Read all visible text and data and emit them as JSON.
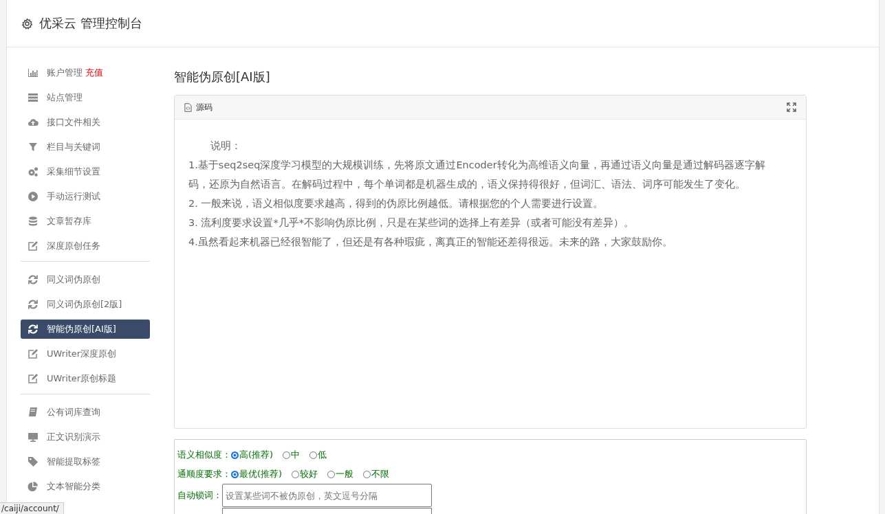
{
  "header": {
    "title": "优采云 管理控制台"
  },
  "sidebar": {
    "groups": [
      {
        "items": [
          {
            "label": "账户管理",
            "badge": "充值",
            "kind": "chart",
            "selected": false
          },
          {
            "label": "站点管理",
            "kind": "server",
            "selected": false
          },
          {
            "label": "接口文件相关",
            "kind": "cloud",
            "selected": false
          },
          {
            "label": "栏目与关键词",
            "kind": "filter",
            "selected": false
          },
          {
            "label": "采集细节设置",
            "kind": "gears",
            "selected": false
          },
          {
            "label": "手动运行测试",
            "kind": "play",
            "selected": false
          },
          {
            "label": "文章暂存库",
            "kind": "db",
            "selected": false
          },
          {
            "label": "深度原创任务",
            "kind": "edit",
            "selected": false
          }
        ]
      },
      {
        "items": [
          {
            "label": "同义词伪原创",
            "kind": "refresh",
            "selected": false
          },
          {
            "label": "同义词伪原创[2版]",
            "kind": "refresh",
            "selected": false
          },
          {
            "label": "智能伪原创[AI版]",
            "kind": "refresh",
            "selected": true
          },
          {
            "label": "UWriter深度原创",
            "kind": "edit",
            "selected": false
          },
          {
            "label": "UWriter原创标题",
            "kind": "edit",
            "selected": false
          }
        ]
      },
      {
        "items": [
          {
            "label": "公有词库查询",
            "kind": "book",
            "selected": false
          },
          {
            "label": "正文识别演示",
            "kind": "monitor",
            "selected": false
          },
          {
            "label": "智能提取标签",
            "kind": "tag",
            "selected": false
          },
          {
            "label": "文本智能分类",
            "kind": "pie",
            "selected": false
          }
        ]
      }
    ]
  },
  "content": {
    "title": "智能伪原创[AI版]",
    "editor": {
      "toolbar_label": "源码",
      "heading": "说明：",
      "paragraphs": [
        "1.基于seq2seq深度学习模型的大规模训练，先将原文通过Encoder转化为高维语义向量，再通过语义向量是通过解码器逐字解码，还原为自然语言。在解码过程中，每个单词都是机器生成的，语义保持得很好，但词汇、语法、词序可能发生了变化。",
        "2. 一般来说，语义相似度要求越高，得到的伪原比例越低。请根据您的个人需要进行设置。",
        "3. 流利度要求设置*几乎*不影响伪原比例，只是在某些词的选择上有差异（或者可能没有差异）。",
        "4.虽然看起来机器已经很智能了，但还是有各种瑕疵，离真正的智能还差得很远。未来的路，大家鼓励你。"
      ]
    },
    "options": [
      {
        "label": "语义相似度：",
        "choices": [
          {
            "label": "高(推荐)",
            "selected": true
          },
          {
            "label": "中",
            "selected": false
          },
          {
            "label": "低",
            "selected": false
          }
        ]
      },
      {
        "label": "通顺度要求：",
        "choices": [
          {
            "label": "最优(推荐)",
            "selected": true
          },
          {
            "label": "较好",
            "selected": false
          },
          {
            "label": "一般",
            "selected": false
          },
          {
            "label": "不限",
            "selected": false
          }
        ]
      }
    ],
    "lock_words": {
      "label": "自动锁词：",
      "placeholder": "设置某些词不被伪原创，英文逗号分隔"
    }
  },
  "status_url": "/caiji/account/"
}
